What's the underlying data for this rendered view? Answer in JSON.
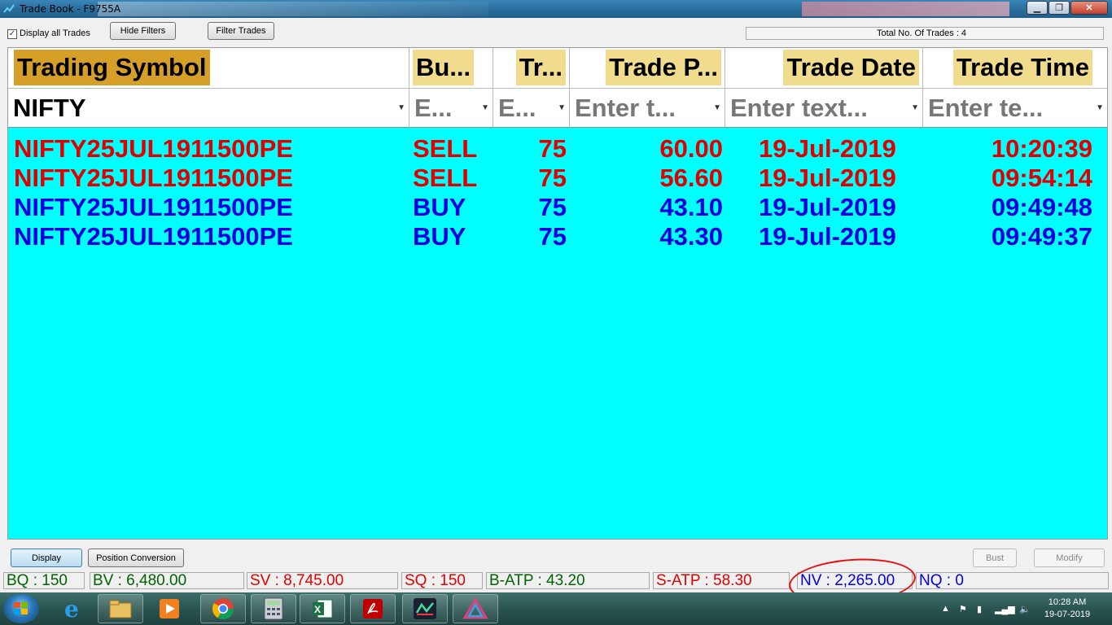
{
  "window": {
    "title": "Trade Book - F9755A"
  },
  "toolbar": {
    "display_all_label": "Display all Trades",
    "display_all_checked": true,
    "hide_filters_label": "Hide Filters",
    "filter_trades_label": "Filter Trades",
    "total_trades_text": "Total No. Of Trades : 4"
  },
  "grid": {
    "columns": [
      {
        "header": "Trading Symbol",
        "filter": "NIFTY"
      },
      {
        "header": "Bu...",
        "filter": "E..."
      },
      {
        "header": "Tr...",
        "filter": "E..."
      },
      {
        "header": "Trade P...",
        "filter": "Enter t..."
      },
      {
        "header": "Trade Date",
        "filter": "Enter text..."
      },
      {
        "header": "Trade Time",
        "filter": "Enter te..."
      }
    ],
    "rows": [
      {
        "symbol": "NIFTY25JUL1911500PE",
        "side": "SELL",
        "qty": "75",
        "price": "60.00",
        "date": "19-Jul-2019",
        "time": "10:20:39",
        "color": "#e00000"
      },
      {
        "symbol": "NIFTY25JUL1911500PE",
        "side": "SELL",
        "qty": "75",
        "price": "56.60",
        "date": "19-Jul-2019",
        "time": "09:54:14",
        "color": "#e00000"
      },
      {
        "symbol": "NIFTY25JUL1911500PE",
        "side": "BUY",
        "qty": "75",
        "price": "43.10",
        "date": "19-Jul-2019",
        "time": "09:49:48",
        "color": "#0000e0"
      },
      {
        "symbol": "NIFTY25JUL1911500PE",
        "side": "BUY",
        "qty": "75",
        "price": "43.30",
        "date": "19-Jul-2019",
        "time": "09:49:37",
        "color": "#0000e0"
      }
    ],
    "background": "#00ffff"
  },
  "actions": {
    "display_label": "Display",
    "position_conversion_label": "Position Conversion",
    "bust_label": "Bust",
    "modify_label": "Modify"
  },
  "status": {
    "bq": "BQ : 150",
    "bv": "BV : 6,480.00",
    "sv": "SV : 8,745.00",
    "sq": "SQ : 150",
    "batp": "B-ATP : 43.20",
    "satp": "S-ATP : 58.30",
    "nv": "NV : 2,265.00",
    "nq": "NQ : 0"
  },
  "taskbar": {
    "apps": [
      "ie-icon",
      "explorer-icon",
      "media-player-icon",
      "chrome-icon",
      "calculator-icon",
      "excel-icon",
      "acrobat-icon",
      "trading-terminal-icon",
      "delta-app-icon"
    ],
    "time": "10:28 AM",
    "date": "19-07-2019"
  }
}
